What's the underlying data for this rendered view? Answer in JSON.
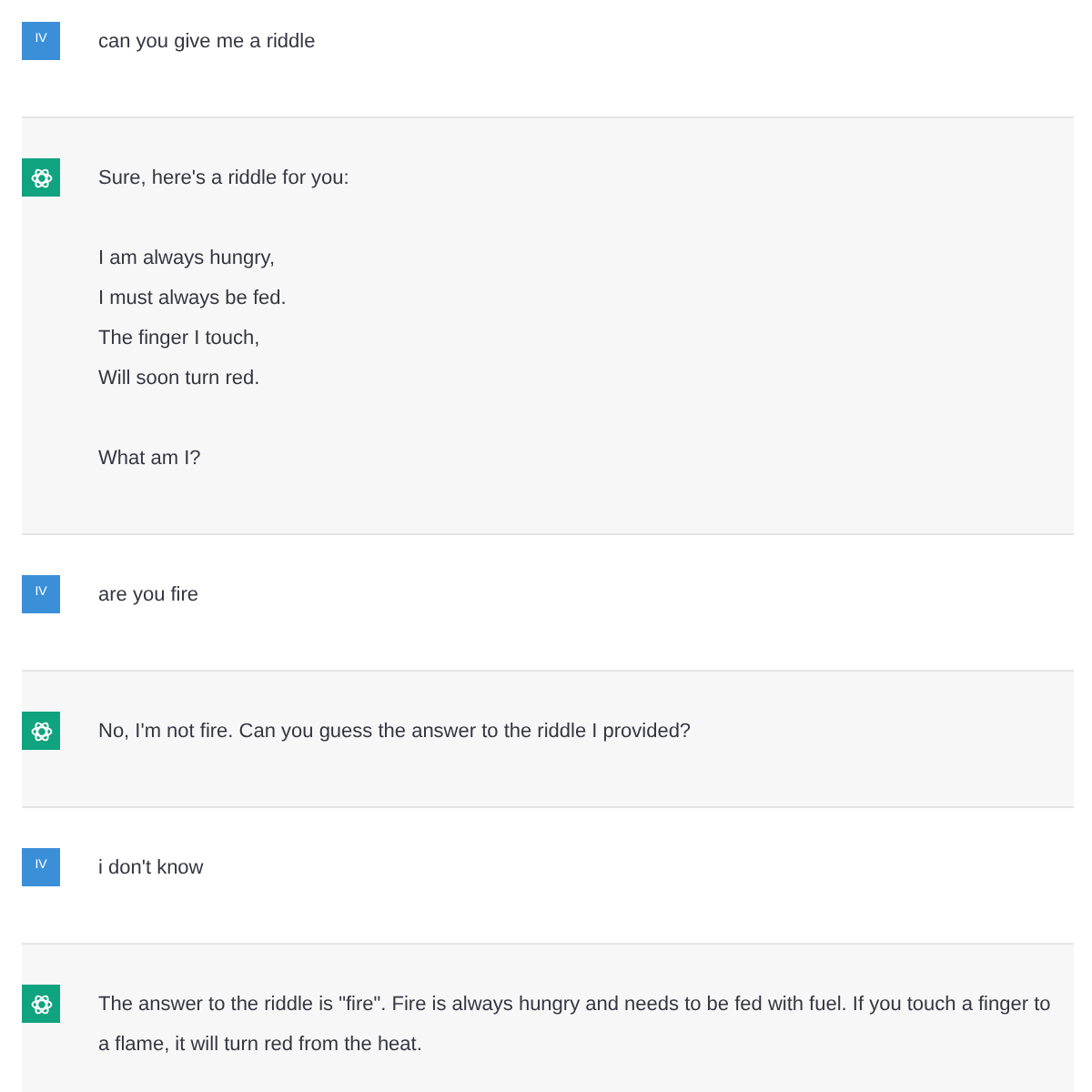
{
  "messages": [
    {
      "kind": "user",
      "avatar": "IV",
      "paragraphs": [
        [
          "can you give me a riddle"
        ]
      ]
    },
    {
      "kind": "assistant",
      "paragraphs": [
        [
          "Sure, here's a riddle for you:"
        ],
        [
          "I am always hungry,",
          "I must always be fed.",
          "The finger I touch,",
          "Will soon turn red."
        ],
        [
          "What am I?"
        ]
      ]
    },
    {
      "kind": "user",
      "avatar": "IV",
      "paragraphs": [
        [
          "are you fire"
        ]
      ]
    },
    {
      "kind": "assistant",
      "paragraphs": [
        [
          "No, I'm not fire. Can you guess the answer to the riddle I provided?"
        ]
      ]
    },
    {
      "kind": "user",
      "avatar": "IV",
      "paragraphs": [
        [
          "i don't know"
        ]
      ]
    },
    {
      "kind": "assistant",
      "paragraphs": [
        [
          "The answer to the riddle is \"fire\". Fire is always hungry and needs to be fed with fuel. If you touch a finger to a flame, it will turn red from the heat."
        ]
      ]
    }
  ]
}
